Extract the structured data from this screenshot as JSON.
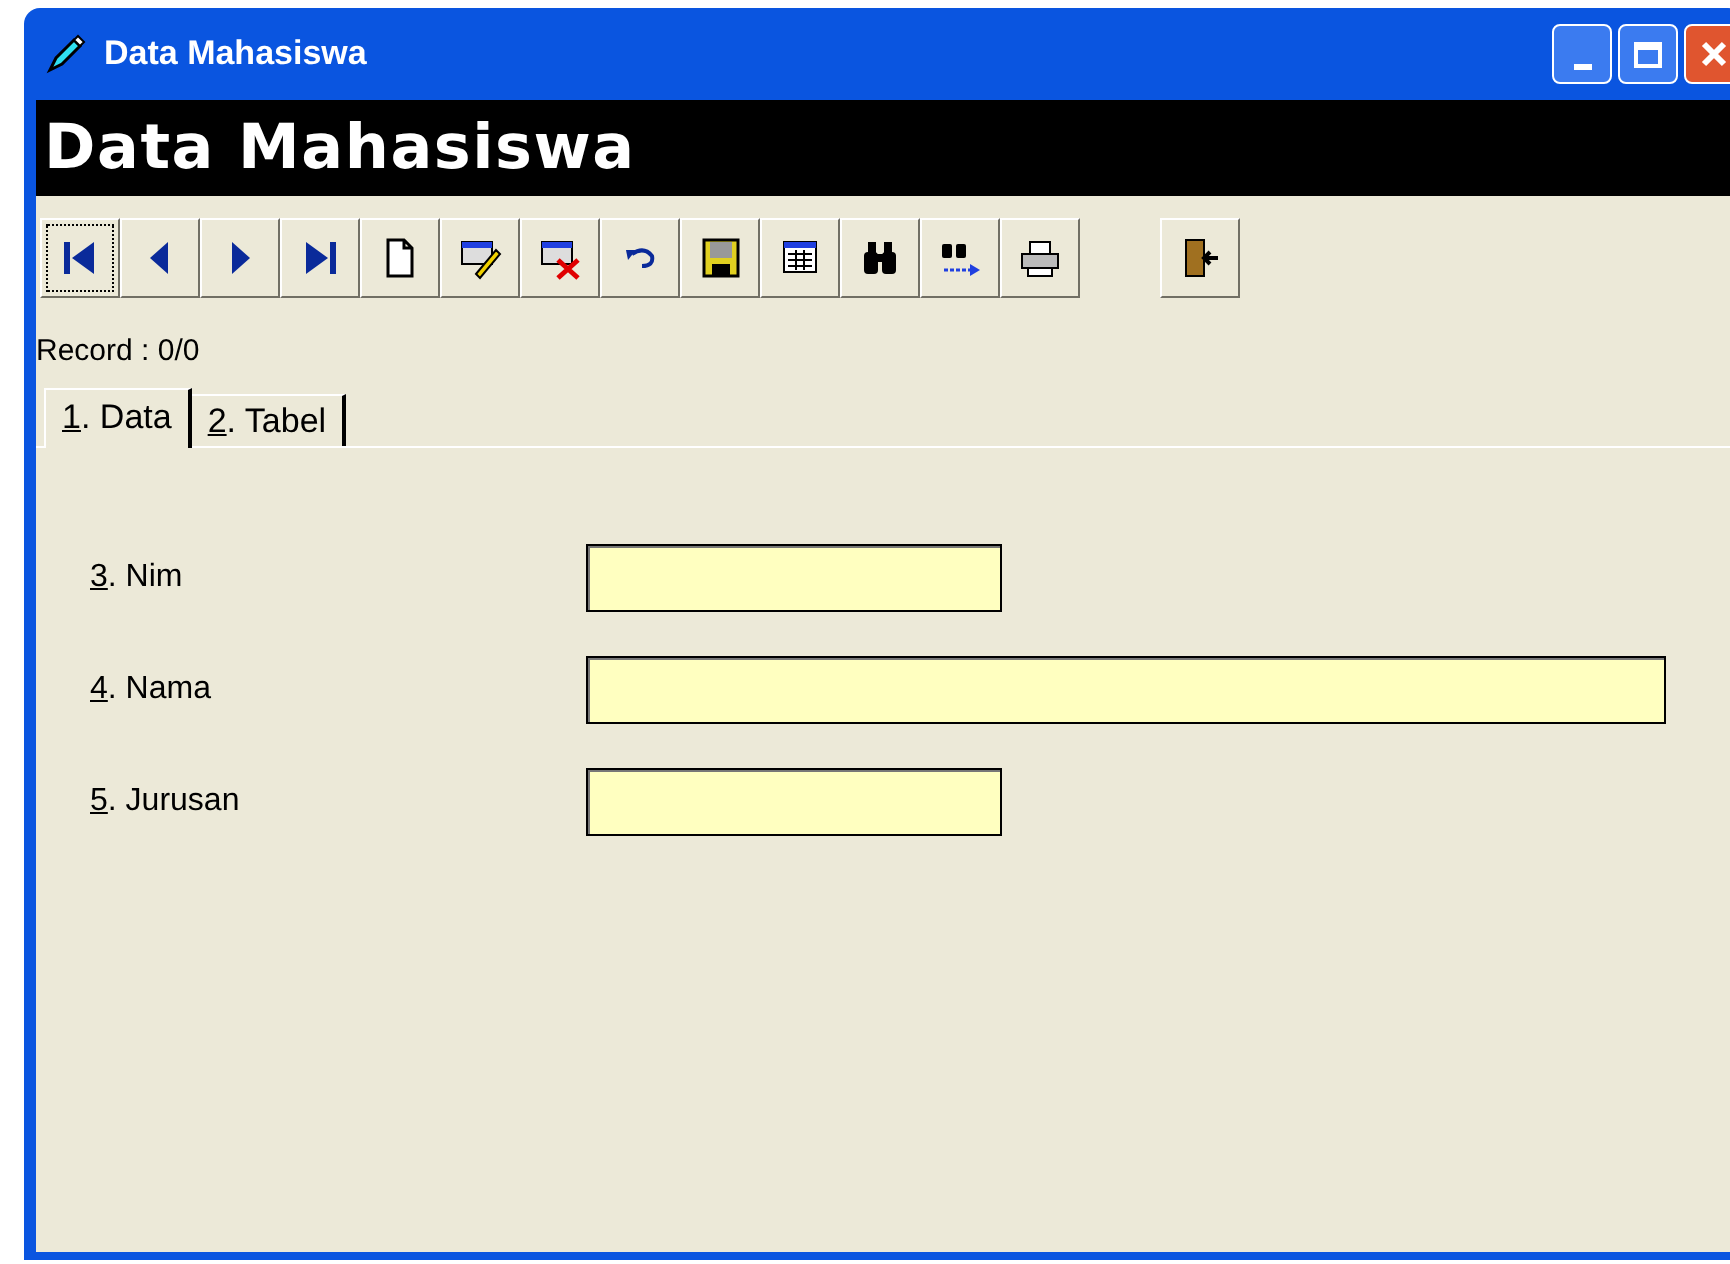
{
  "window": {
    "title": "Data Mahasiswa"
  },
  "header": {
    "title": "Data Mahasiswa"
  },
  "toolbar": [
    {
      "kind": "first",
      "focused": true
    },
    {
      "kind": "prev",
      "focused": false
    },
    {
      "kind": "next",
      "focused": false
    },
    {
      "kind": "last",
      "focused": false
    },
    {
      "kind": "new",
      "focused": false
    },
    {
      "kind": "edit",
      "focused": false
    },
    {
      "kind": "delete",
      "focused": false
    },
    {
      "kind": "undo",
      "focused": false
    },
    {
      "kind": "save",
      "focused": false
    },
    {
      "kind": "table",
      "focused": false
    },
    {
      "kind": "find",
      "focused": false
    },
    {
      "kind": "findnext",
      "focused": false
    },
    {
      "kind": "print",
      "focused": false
    },
    {
      "kind": "exit",
      "focused": false
    }
  ],
  "record": "Record : 0/0",
  "tabs": [
    {
      "label": "1. Data",
      "selected": true
    },
    {
      "label": "2. Tabel",
      "selected": false
    }
  ],
  "fields": [
    {
      "label": "3. Nim",
      "kind": "short"
    },
    {
      "label": "4. Nama",
      "kind": "long"
    },
    {
      "label": "5. Jurusan",
      "kind": "short"
    }
  ]
}
